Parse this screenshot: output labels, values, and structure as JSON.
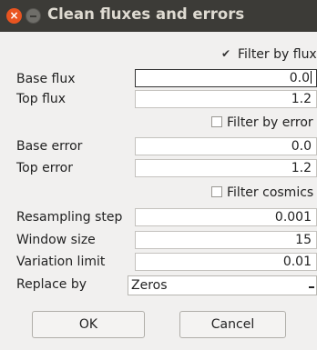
{
  "window": {
    "title": "Clean fluxes and errors"
  },
  "filter_flux": {
    "label": "Filter by flux",
    "checked": true
  },
  "base_flux": {
    "label": "Base flux",
    "value": "0.0"
  },
  "top_flux": {
    "label": "Top flux",
    "value": "1.2"
  },
  "filter_error": {
    "label": "Filter by error",
    "checked": false
  },
  "base_error": {
    "label": "Base error",
    "value": "0.0"
  },
  "top_error": {
    "label": "Top error",
    "value": "1.2"
  },
  "filter_cosmics": {
    "label": "Filter cosmics",
    "checked": false
  },
  "resampling_step": {
    "label": "Resampling step",
    "value": "0.001"
  },
  "window_size": {
    "label": "Window size",
    "value": "15"
  },
  "variation_limit": {
    "label": "Variation limit",
    "value": "0.01"
  },
  "replace_by": {
    "label": "Replace by",
    "selected": "Zeros"
  },
  "buttons": {
    "ok": "OK",
    "cancel": "Cancel"
  }
}
